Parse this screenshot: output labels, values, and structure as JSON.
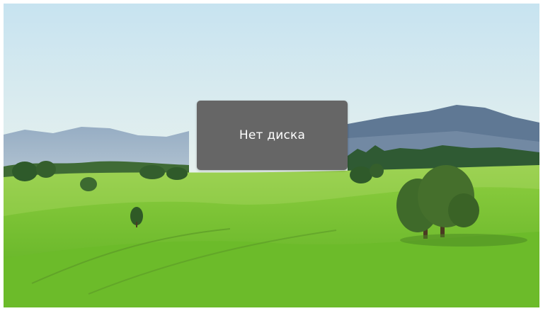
{
  "dialog": {
    "message": "Нет диска"
  },
  "colors": {
    "dialog_background": "#666666",
    "dialog_text": "#ffffff"
  },
  "wallpaper": {
    "description_icon": "landscape-wallpaper"
  }
}
